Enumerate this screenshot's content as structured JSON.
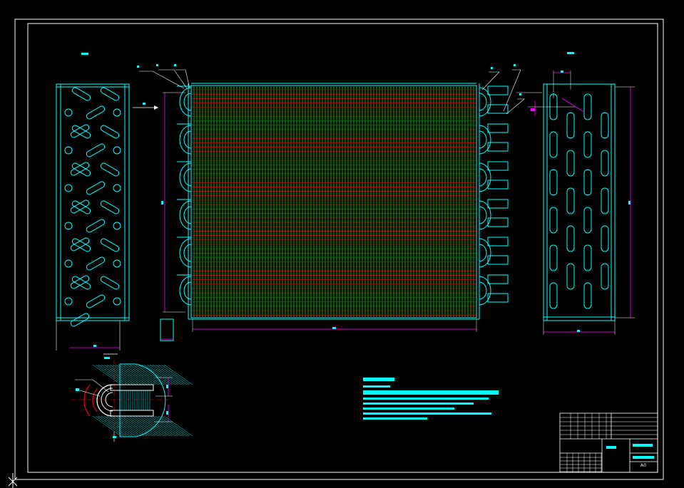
{
  "drawing": {
    "sheet_code": "A0",
    "background": "#000000",
    "colors": {
      "frame": "#ffffff",
      "outline": "#00ffff",
      "fin": "#00ff00",
      "tube": "#ff0000",
      "dimension": "#ff00ff",
      "leader": "#ffffff",
      "text": "#00ffff"
    }
  }
}
